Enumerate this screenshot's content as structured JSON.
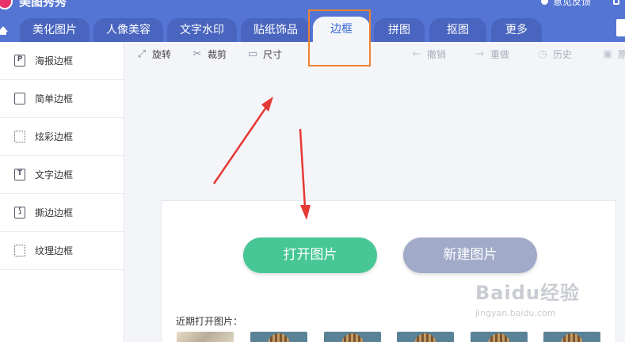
{
  "app": {
    "title": "美图秀秀",
    "feedback": "意见反馈"
  },
  "tabs": [
    {
      "label": "美化图片",
      "active": false
    },
    {
      "label": "人像美容",
      "active": false
    },
    {
      "label": "文字水印",
      "active": false
    },
    {
      "label": "贴纸饰品",
      "active": false
    },
    {
      "label": "边框",
      "active": true
    },
    {
      "label": "拼图",
      "active": false
    },
    {
      "label": "抠图",
      "active": false
    },
    {
      "label": "更多",
      "active": false
    }
  ],
  "sidebar": {
    "items": [
      {
        "label": "海报边框",
        "icon": "poster-frame-icon"
      },
      {
        "label": "简单边框",
        "icon": "simple-frame-icon"
      },
      {
        "label": "炫彩边框",
        "icon": "colorful-frame-icon"
      },
      {
        "label": "文字边框",
        "icon": "text-frame-icon"
      },
      {
        "label": "撕边边框",
        "icon": "torn-frame-icon"
      },
      {
        "label": "纹理边框",
        "icon": "texture-frame-icon"
      }
    ]
  },
  "toolbar": {
    "rotate": "旋转",
    "crop": "裁剪",
    "size": "尺寸",
    "undo": "撤销",
    "redo": "重做",
    "history": "历史",
    "more_cut": "原"
  },
  "main": {
    "open_button": "打开图片",
    "new_button": "新建图片",
    "recent_label": "近期打开图片："
  },
  "watermark": {
    "main": "Baidu经验",
    "sub": "jingyan.baidu.com"
  },
  "colors": {
    "header": "#5575d4",
    "tab": "#4965bf",
    "active_tab_text": "#2e62cf",
    "open_button": "#47c795",
    "new_button": "#a1aac8",
    "annotation_arrow": "#e53935",
    "annotation_box": "#f0822f"
  }
}
